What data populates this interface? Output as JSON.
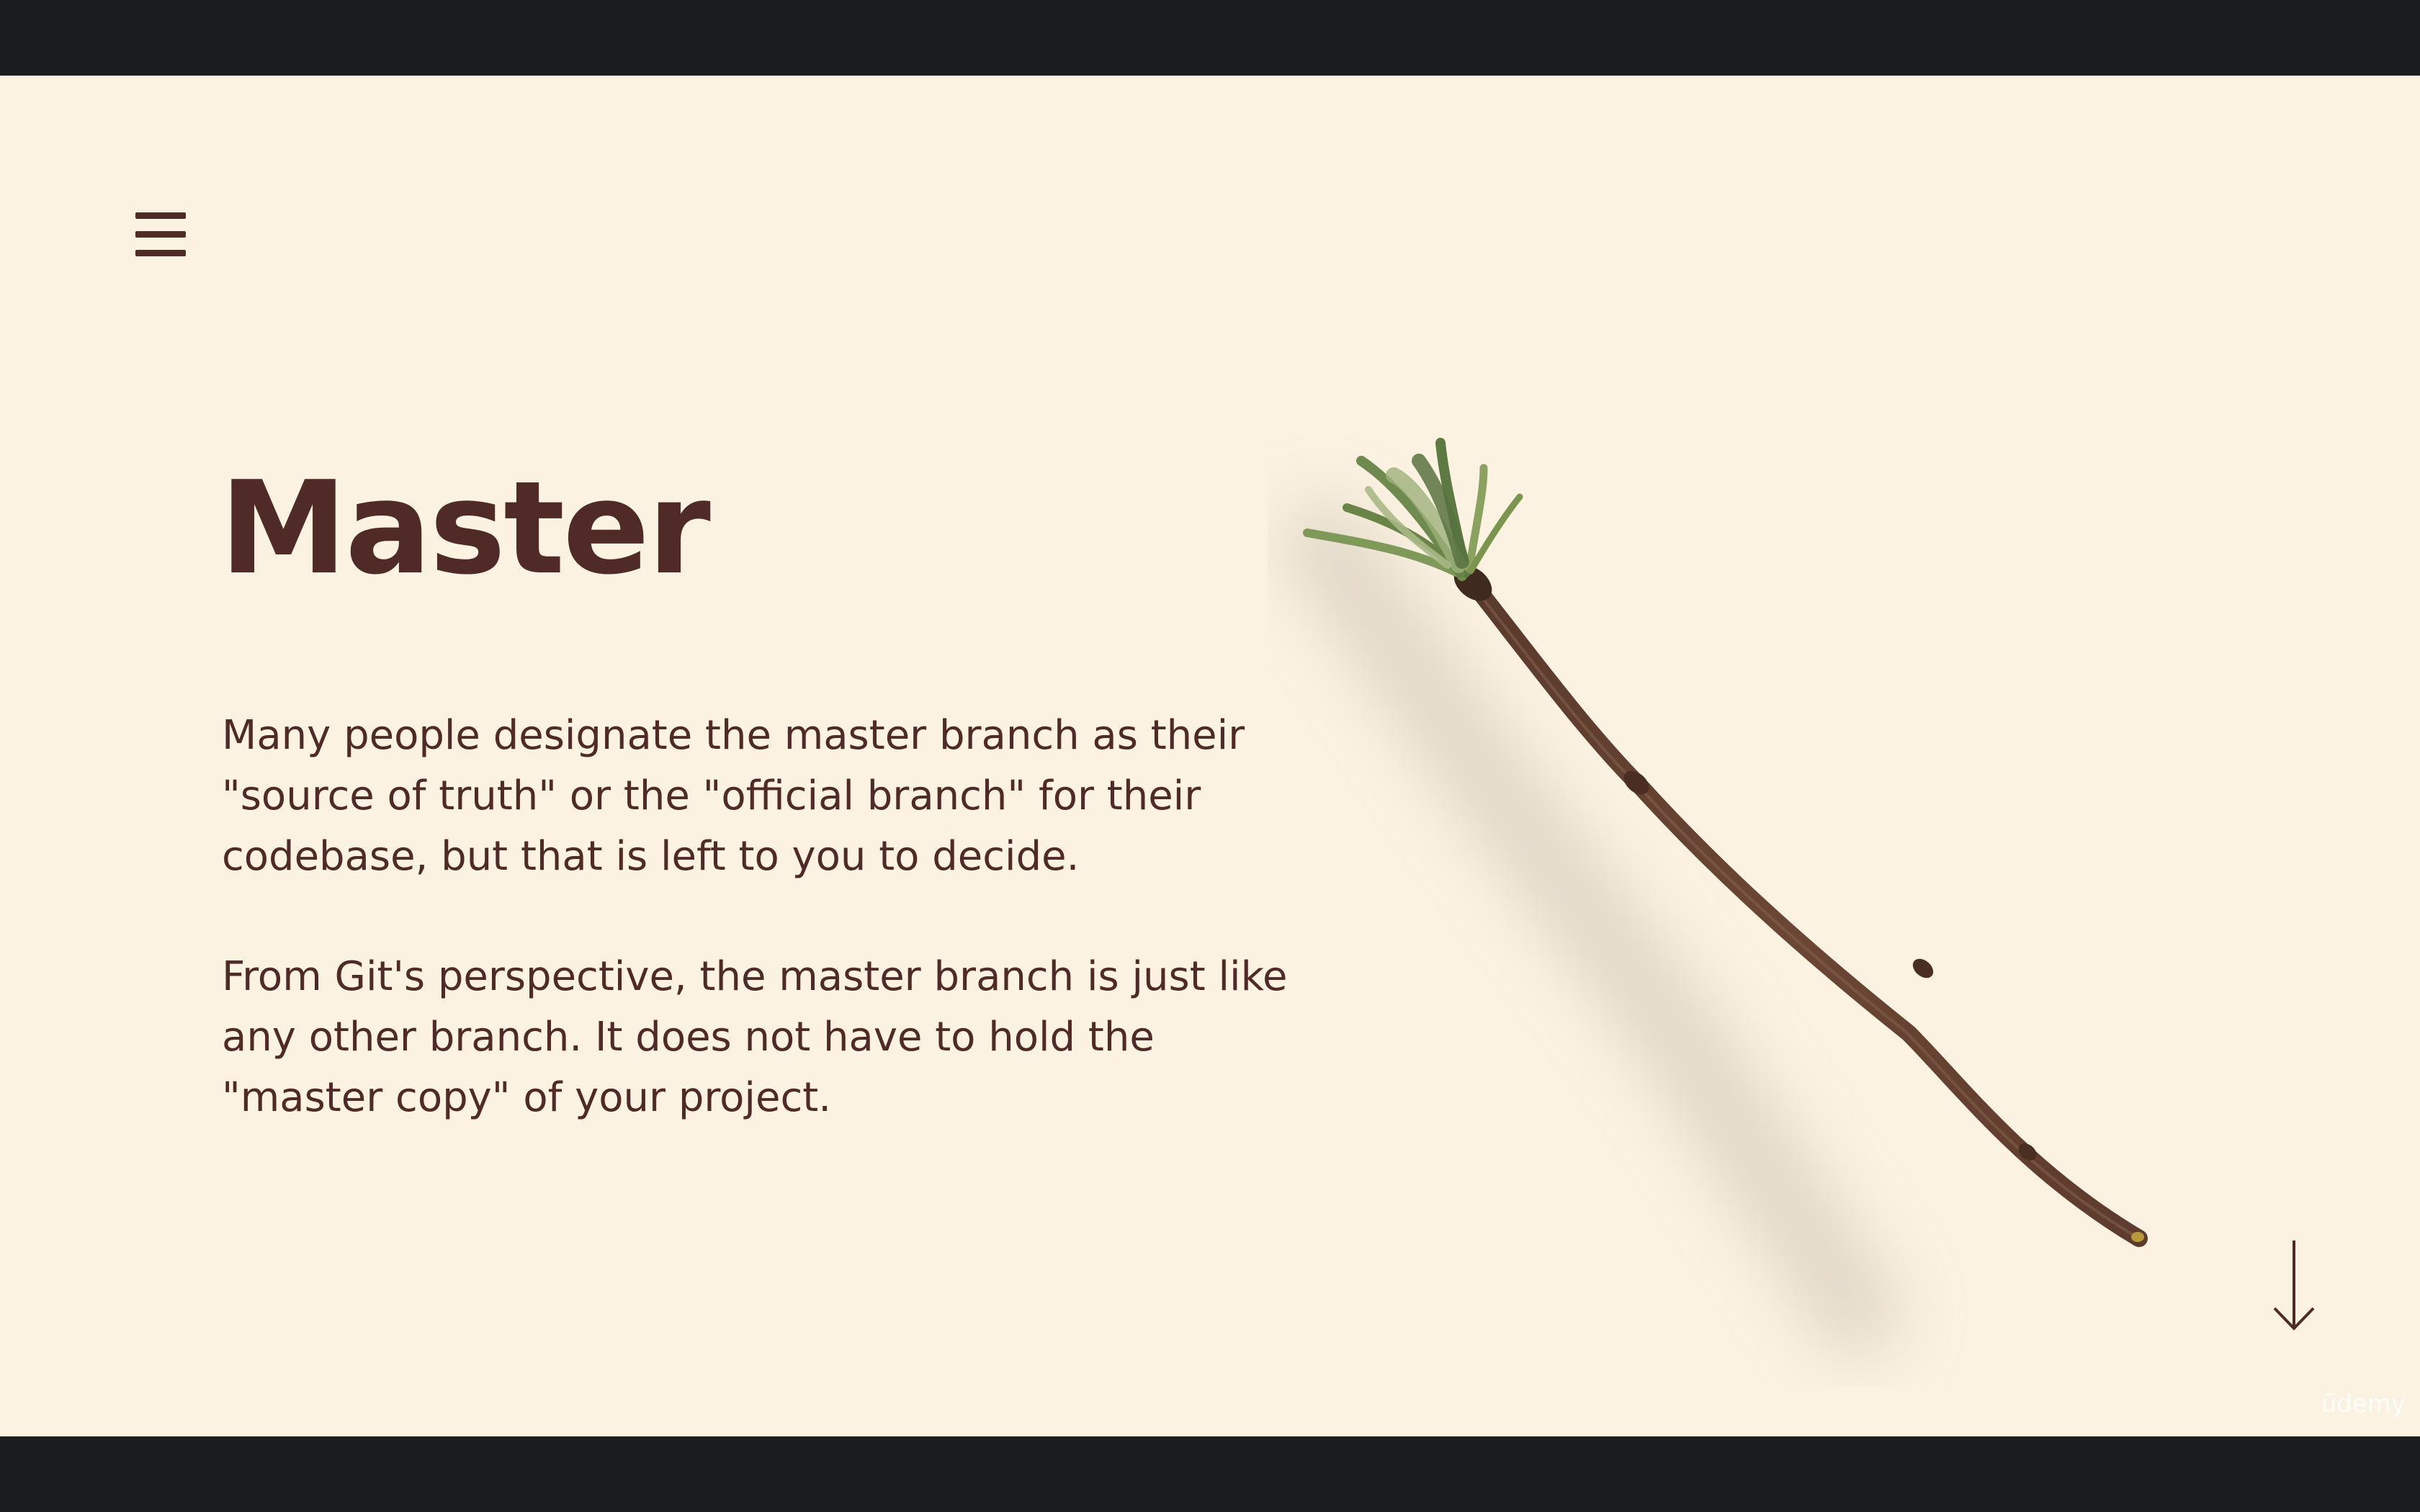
{
  "slide": {
    "title": "Master",
    "paragraphs": [
      "Many people designate the master branch as their\n\"source of truth\" or the \"official branch\" for their\ncodebase, but that is left to you to decide.",
      "From Git's perspective, the master branch is just like\nany other branch.  It does not have to hold the\n\"master copy\" of your project."
    ]
  },
  "icons": {
    "menu": "hamburger-menu-icon",
    "scroll": "arrow-down-icon",
    "illustration": "twig-image"
  },
  "watermark": "ūdemy",
  "colors": {
    "background": "#fcf2e2",
    "text": "#4f2a26",
    "letterbox": "#1b1c1f"
  }
}
